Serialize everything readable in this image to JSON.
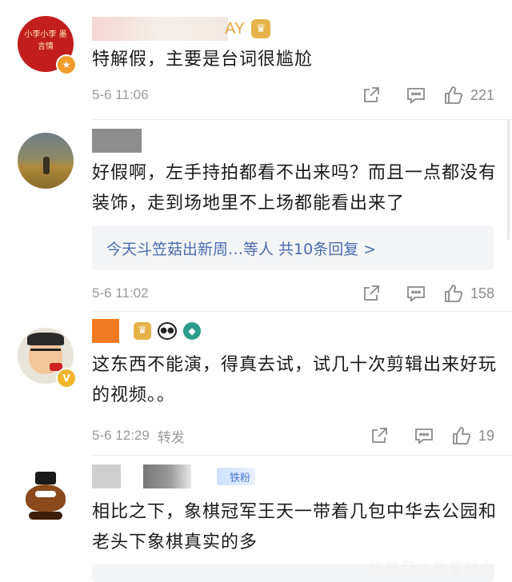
{
  "comments": [
    {
      "avatar_text": "小李小李 墨言情",
      "name_visible": "AY",
      "content": "特解假，主要是台词很尴尬",
      "time": "5-6 11:06",
      "likes": "221"
    },
    {
      "content": "好假啊，左手持拍都看不出来吗？而且一点都没有装饰，走到场地里不上场都能看出来了",
      "reply_summary": "今天斗笠菇出新周…等人  共10条回复 >",
      "time": "5-6 11:02",
      "likes": "158"
    },
    {
      "content": "这东西不能演，得真去试，试几十次剪辑出来好玩的视频。。",
      "time": "5-6 12:29",
      "repost": "转发",
      "likes": "19"
    },
    {
      "fan_badge": "铁粉",
      "content": "相比之下，象棋冠军王天一带着几包中华去公园和老头下象棋真实的多"
    }
  ],
  "watermark": "快传号 / 化答妹力",
  "colors": {
    "link": "#4a6bb0",
    "meta": "#9a9a9a",
    "reply_bg": "#f4f5f7"
  },
  "icons": [
    "share-icon",
    "comment-icon",
    "thumbs-up-icon",
    "vip-badge-icon"
  ]
}
